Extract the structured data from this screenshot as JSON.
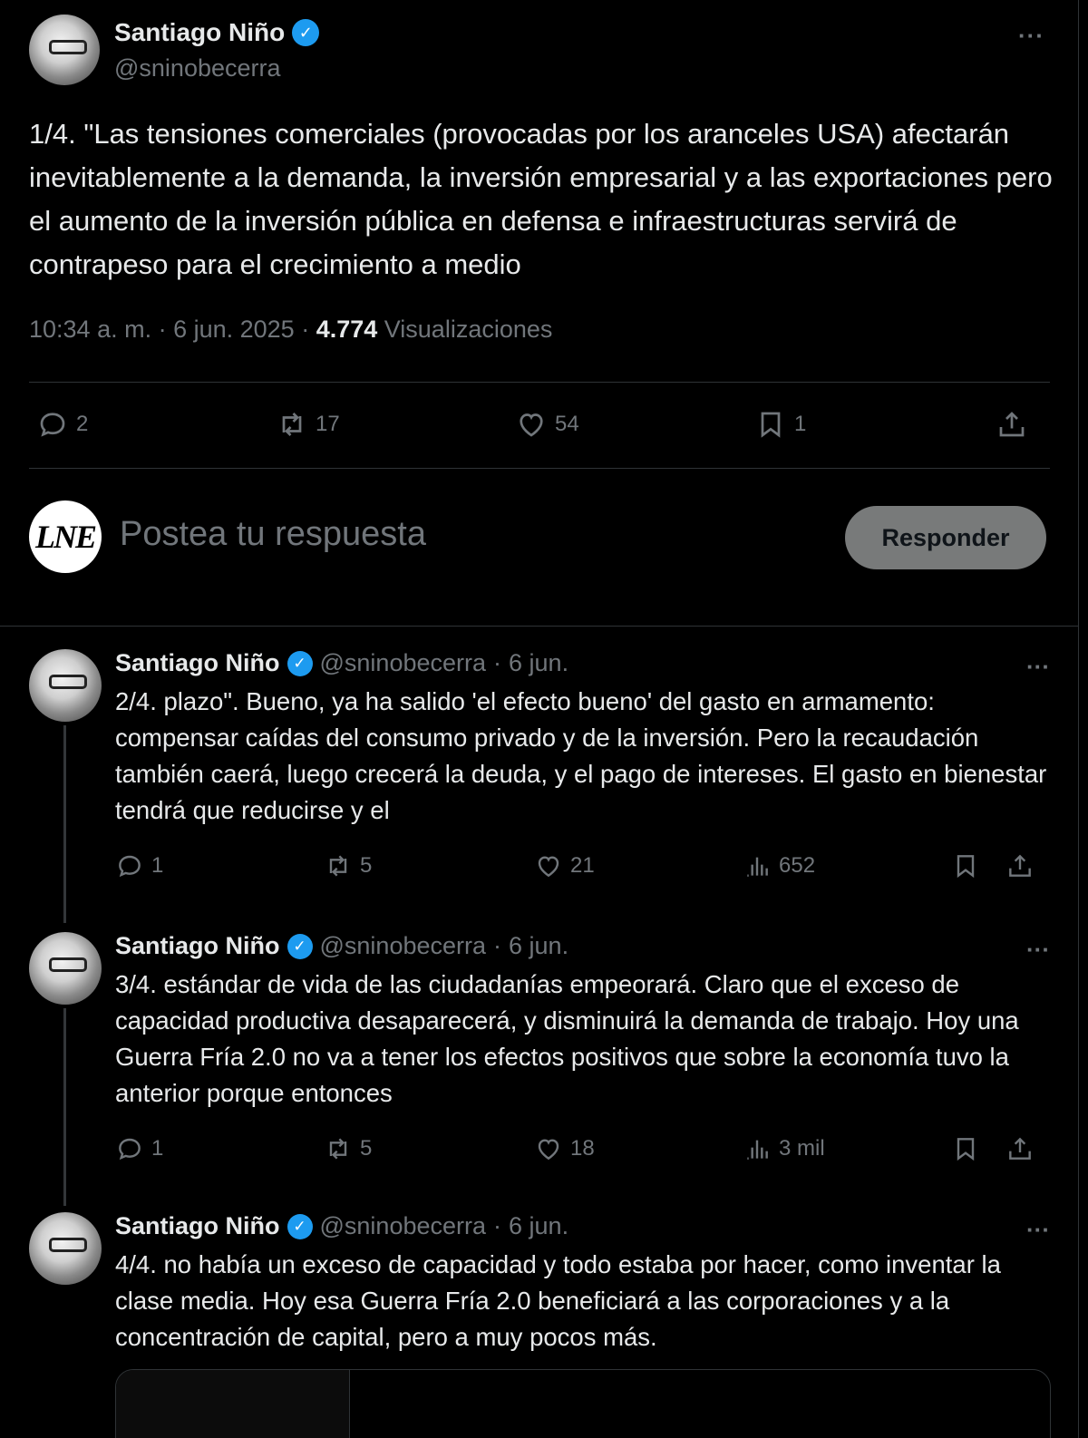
{
  "main_tweet": {
    "author_name": "Santiago Niño",
    "handle": "@sninobecerra",
    "more": "···",
    "text": "1/4. \"Las tensiones comerciales (provocadas por los aranceles USA) afectarán inevitablemente a la demanda, la inversión empresarial y a las exportaciones pero el aumento de la inversión pública en defensa e infraestructuras servirá de contrapeso para el crecimiento a medio",
    "time": "10:34 a. m. · 6 jun. 2025 · ",
    "views_count": "4.774",
    "views_label": " Visualizaciones",
    "replies": "2",
    "reposts": "17",
    "likes": "54",
    "bookmarks": "1"
  },
  "reply_box": {
    "avatar_text": "LNE",
    "placeholder": "Postea tu respuesta",
    "button": "Responder"
  },
  "thread": [
    {
      "author_name": "Santiago Niño",
      "handle": "@sninobecerra",
      "dot": "·",
      "date": "6 jun.",
      "more": "···",
      "text": "2/4. plazo\". Bueno, ya ha salido 'el efecto bueno' del gasto en armamento: compensar caídas del consumo privado y de la inversión. Pero la recaudación también caerá, luego crecerá la deuda, y el pago de intereses. El gasto en bienestar tendrá que reducirse y el",
      "replies": "1",
      "reposts": "5",
      "likes": "21",
      "views": "652"
    },
    {
      "author_name": "Santiago Niño",
      "handle": "@sninobecerra",
      "dot": "·",
      "date": "6 jun.",
      "more": "···",
      "text": "3/4. estándar de vida de las ciudadanías empeorará. Claro que el exceso de capacidad productiva desaparecerá, y disminuirá la demanda de trabajo. Hoy una Guerra Fría 2.0 no va a tener los efectos positivos que sobre la economía tuvo la anterior porque entonces",
      "replies": "1",
      "reposts": "5",
      "likes": "18",
      "views": "3 mil"
    },
    {
      "author_name": "Santiago Niño",
      "handle": "@sninobecerra",
      "dot": "·",
      "date": "6 jun.",
      "more": "···",
      "text": "4/4. no había un exceso de capacidad y todo estaba por hacer, como inventar la clase media. Hoy esa Guerra Fría 2.0 beneficiará a las corporaciones y a la concentración de capital, pero a muy pocos más."
    }
  ],
  "colors": {
    "background": "#000000",
    "text": "#e7e9ea",
    "muted": "#71767b",
    "verified": "#1d9bf0",
    "border": "#2f3336"
  },
  "icons": [
    "verified-badge-icon",
    "more-icon",
    "reply-icon",
    "repost-icon",
    "like-icon",
    "bookmark-icon",
    "share-icon",
    "views-icon"
  ]
}
